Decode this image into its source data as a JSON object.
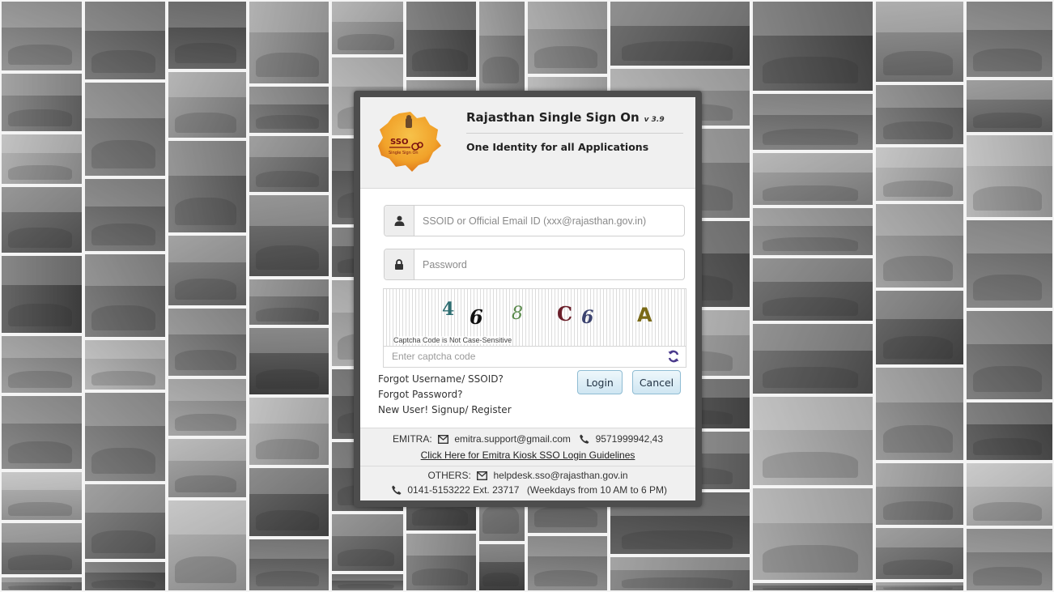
{
  "colors": {
    "panel_border": "#4d4d4d",
    "header_bg": "#f0f0f0",
    "button_bg": "#d8ecf6",
    "refresh_icon": "#4a3a8c",
    "logo_orange": "#f1a22a"
  },
  "header": {
    "title": "Rajasthan Single Sign On",
    "version": "v 3.9",
    "tagline": "One Identity for all Applications",
    "logo": {
      "text_top": "SSO",
      "text_bottom": "Single Sign On",
      "icon": "rajasthan-map-logo"
    }
  },
  "login_form": {
    "username_placeholder": "SSOID or Official Email ID (xxx@rajasthan.gov.in)",
    "username_icon": "user-icon",
    "password_placeholder": "Password",
    "password_icon": "lock-icon",
    "captcha": {
      "characters": [
        {
          "char": "4",
          "color": "#2f6f73"
        },
        {
          "char": "6",
          "color": "#111111"
        },
        {
          "char": "8",
          "color": "#5a8a4c"
        },
        {
          "char": "C",
          "color": "#6b1f2a"
        },
        {
          "char": "6",
          "color": "#3c4470"
        },
        {
          "char": "A",
          "color": "#7a6a16"
        }
      ],
      "note": "Captcha Code is Not Case-Sensitive",
      "input_placeholder": "Enter captcha code",
      "refresh_icon": "refresh-icon"
    },
    "links": {
      "forgot_username": "Forgot Username/ SSOID?",
      "forgot_password": "Forgot Password?",
      "signup": "New User! Signup/ Register"
    },
    "buttons": {
      "login": "Login",
      "cancel": "Cancel"
    }
  },
  "footer": {
    "emitra": {
      "label": "EMITRA:",
      "email": "emitra.support@gmail.com",
      "phone": "9571999942,43",
      "guidelines_link": "Click Here for Emitra Kiosk SSO Login Guidelines"
    },
    "others": {
      "label": "OTHERS:",
      "email": "helpdesk.sso@rajasthan.gov.in",
      "phone": "0141-5153222 Ext. 23717",
      "hours": "(Weekdays from 10 AM to 6 PM)"
    }
  }
}
